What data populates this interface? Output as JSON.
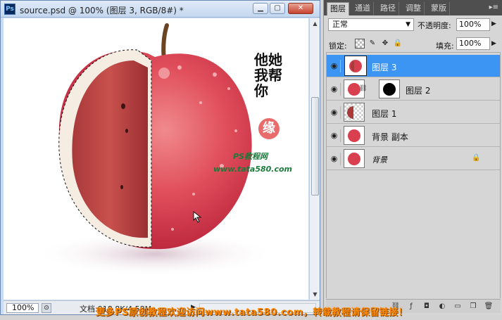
{
  "document": {
    "title": "source.psd @ 100% (图层 3, RGB/8#) *",
    "app_icon": "Ps",
    "buttons": {
      "minimize": "▁",
      "maximize": "▢",
      "close": "✕"
    },
    "zoom": "100%",
    "doc_info": "文档:918.8K/4.58M",
    "canvas_text": {
      "calligraphy": [
        "他",
        "她",
        "我",
        "帮",
        "你"
      ],
      "seal": "缘",
      "site_name": "PS教程网",
      "site_url": "www.tata580.com"
    }
  },
  "layers_panel": {
    "tabs": [
      "图层",
      "通道",
      "路径",
      "调整",
      "蒙版"
    ],
    "active_tab": "图层",
    "menu_icon": "▸≡",
    "blend_mode": "正常",
    "opacity_label": "不透明度:",
    "opacity": "100%",
    "lock_label": "锁定:",
    "fill_label": "填充:",
    "fill": "100%",
    "layers": [
      {
        "name": "图层 3",
        "selected": true,
        "has_mask": false,
        "locked": false
      },
      {
        "name": "图层 2",
        "selected": false,
        "has_mask": true,
        "locked": false
      },
      {
        "name": "图层 1",
        "selected": false,
        "has_mask": false,
        "locked": false
      },
      {
        "name": "背景 副本",
        "selected": false,
        "has_mask": false,
        "locked": false
      },
      {
        "name": "背景",
        "selected": false,
        "has_mask": false,
        "locked": true
      }
    ]
  },
  "watermark": "更多PS原创教程欢迎访问www.tata580.com，转载教程请保留链接！",
  "colors": {
    "selection": "#3d95f3",
    "watermark": "#ff8a00",
    "apple": "#d8404f"
  }
}
